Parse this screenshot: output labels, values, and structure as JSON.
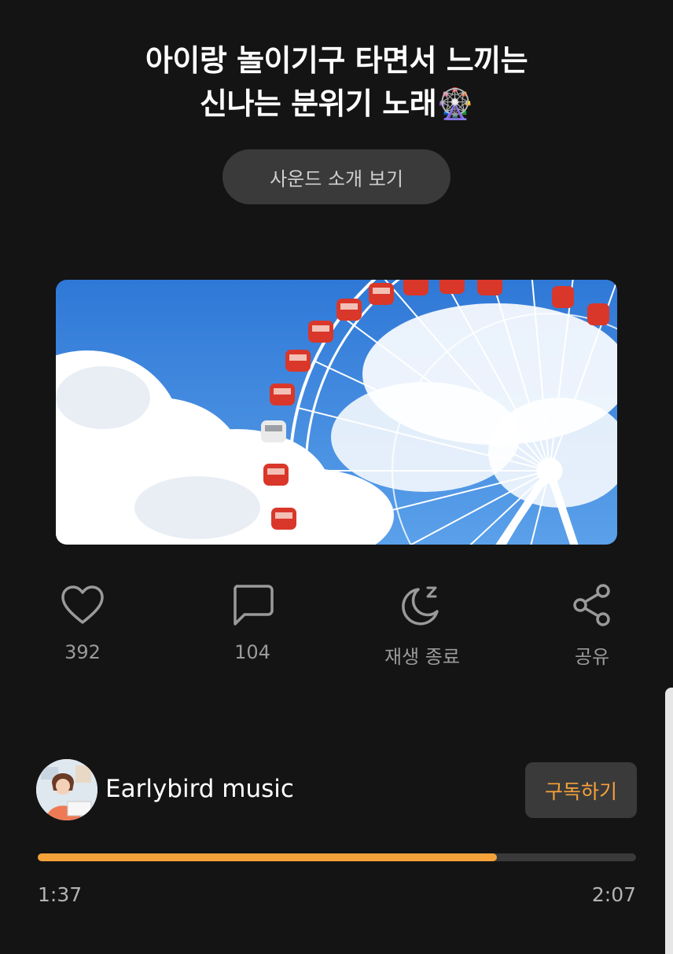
{
  "title": {
    "line1": "아이랑 놀이기구 타면서 느끼는",
    "line2": "신나는 분위기 노래🎡"
  },
  "intro_button": "사운드 소개 보기",
  "actions": [
    {
      "icon": "heart-icon",
      "label": "392"
    },
    {
      "icon": "comment-icon",
      "label": "104"
    },
    {
      "icon": "sleep-timer-icon",
      "label": "재생 종료"
    },
    {
      "icon": "share-icon",
      "label": "공유"
    }
  ],
  "channel": {
    "name": "Earlybird music",
    "subscribe_label": "구독하기"
  },
  "player": {
    "current_time": "1:37",
    "total_time": "2:07",
    "progress": 0.767
  },
  "colors": {
    "accent": "#f5a23a",
    "background": "#141414",
    "button_bg": "#3a3a3a"
  }
}
